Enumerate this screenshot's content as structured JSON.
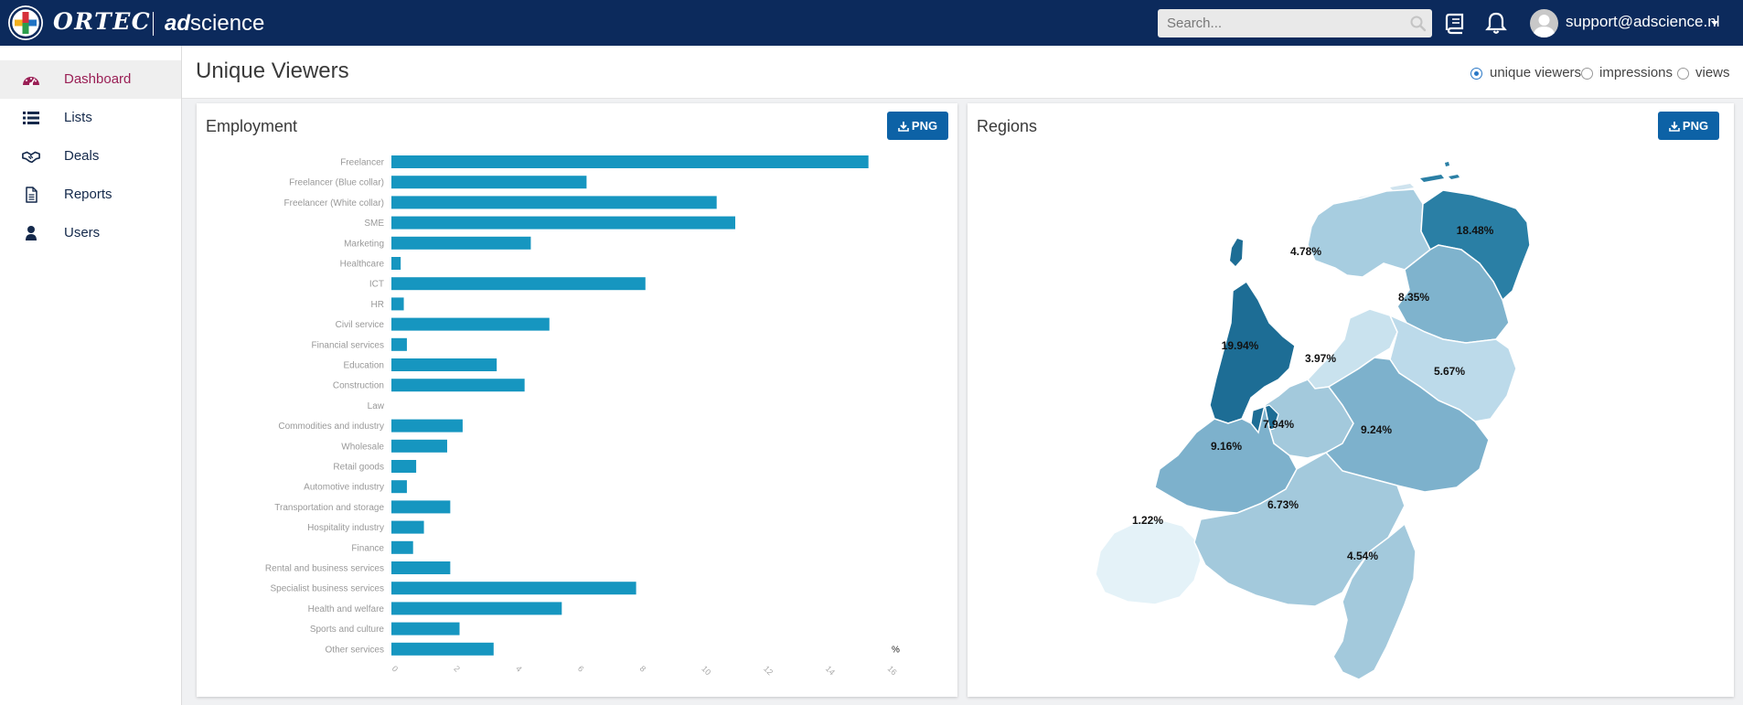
{
  "header": {
    "logo_text": "ORTEC",
    "logo_sub_bold": "ad",
    "logo_sub_rest": "science",
    "search_placeholder": "Search...",
    "user_email": "support@adscience.nl"
  },
  "sidebar": {
    "items": [
      {
        "label": "Dashboard",
        "icon": "dashboard-icon",
        "active": true
      },
      {
        "label": "Lists",
        "icon": "list-icon",
        "active": false
      },
      {
        "label": "Deals",
        "icon": "handshake-icon",
        "active": false
      },
      {
        "label": "Reports",
        "icon": "document-icon",
        "active": false
      },
      {
        "label": "Users",
        "icon": "user-icon",
        "active": false
      }
    ]
  },
  "page": {
    "title": "Unique Viewers",
    "metric_options": [
      {
        "label": "unique viewers",
        "selected": true
      },
      {
        "label": "impressions",
        "selected": false
      },
      {
        "label": "views",
        "selected": false
      }
    ]
  },
  "employment_card": {
    "title": "Employment",
    "png_label": "PNG"
  },
  "regions_card": {
    "title": "Regions",
    "png_label": "PNG"
  },
  "colors": {
    "topbar": "#0c2a5c",
    "accent_active": "#9a1f55",
    "bar": "#1696c0",
    "button": "#0d62a6"
  },
  "chart_data": [
    {
      "type": "bar",
      "orientation": "horizontal",
      "categories": [
        "Freelancer",
        "Freelancer (Blue collar)",
        "Freelancer (White collar)",
        "SME",
        "Marketing",
        "Healthcare",
        "ICT",
        "HR",
        "Civil service",
        "Financial services",
        "Education",
        "Construction",
        "Law",
        "Commodities and industry",
        "Wholesale",
        "Retail goods",
        "Automotive industry",
        "Transportation and storage",
        "Hospitality industry",
        "Finance",
        "Rental and business services",
        "Specialist business services",
        "Health and welfare",
        "Sports and culture",
        "Other services"
      ],
      "values": [
        15.4,
        6.3,
        10.5,
        11.1,
        4.5,
        0.3,
        8.2,
        0.4,
        5.1,
        0.5,
        3.4,
        4.3,
        0,
        2.3,
        1.8,
        0.8,
        0.5,
        1.9,
        1.05,
        0.7,
        1.9,
        7.9,
        5.5,
        2.2,
        3.3
      ],
      "unit": "%",
      "xlim": [
        0,
        16
      ],
      "xticks": [
        0,
        2,
        4,
        6,
        8,
        10,
        12,
        14,
        16
      ],
      "grid": false,
      "title": "",
      "xlabel": "",
      "ylabel": ""
    },
    {
      "type": "choropleth",
      "labels": [
        "18.48%",
        "4.78%",
        "8.35%",
        "3.97%",
        "19.94%",
        "5.67%",
        "7.94%",
        "9.24%",
        "9.16%",
        "6.73%",
        "1.22%",
        "4.54%"
      ],
      "values": [
        18.48,
        4.78,
        8.35,
        3.97,
        19.94,
        5.67,
        7.94,
        9.24,
        9.16,
        6.73,
        1.22,
        4.54
      ]
    }
  ]
}
